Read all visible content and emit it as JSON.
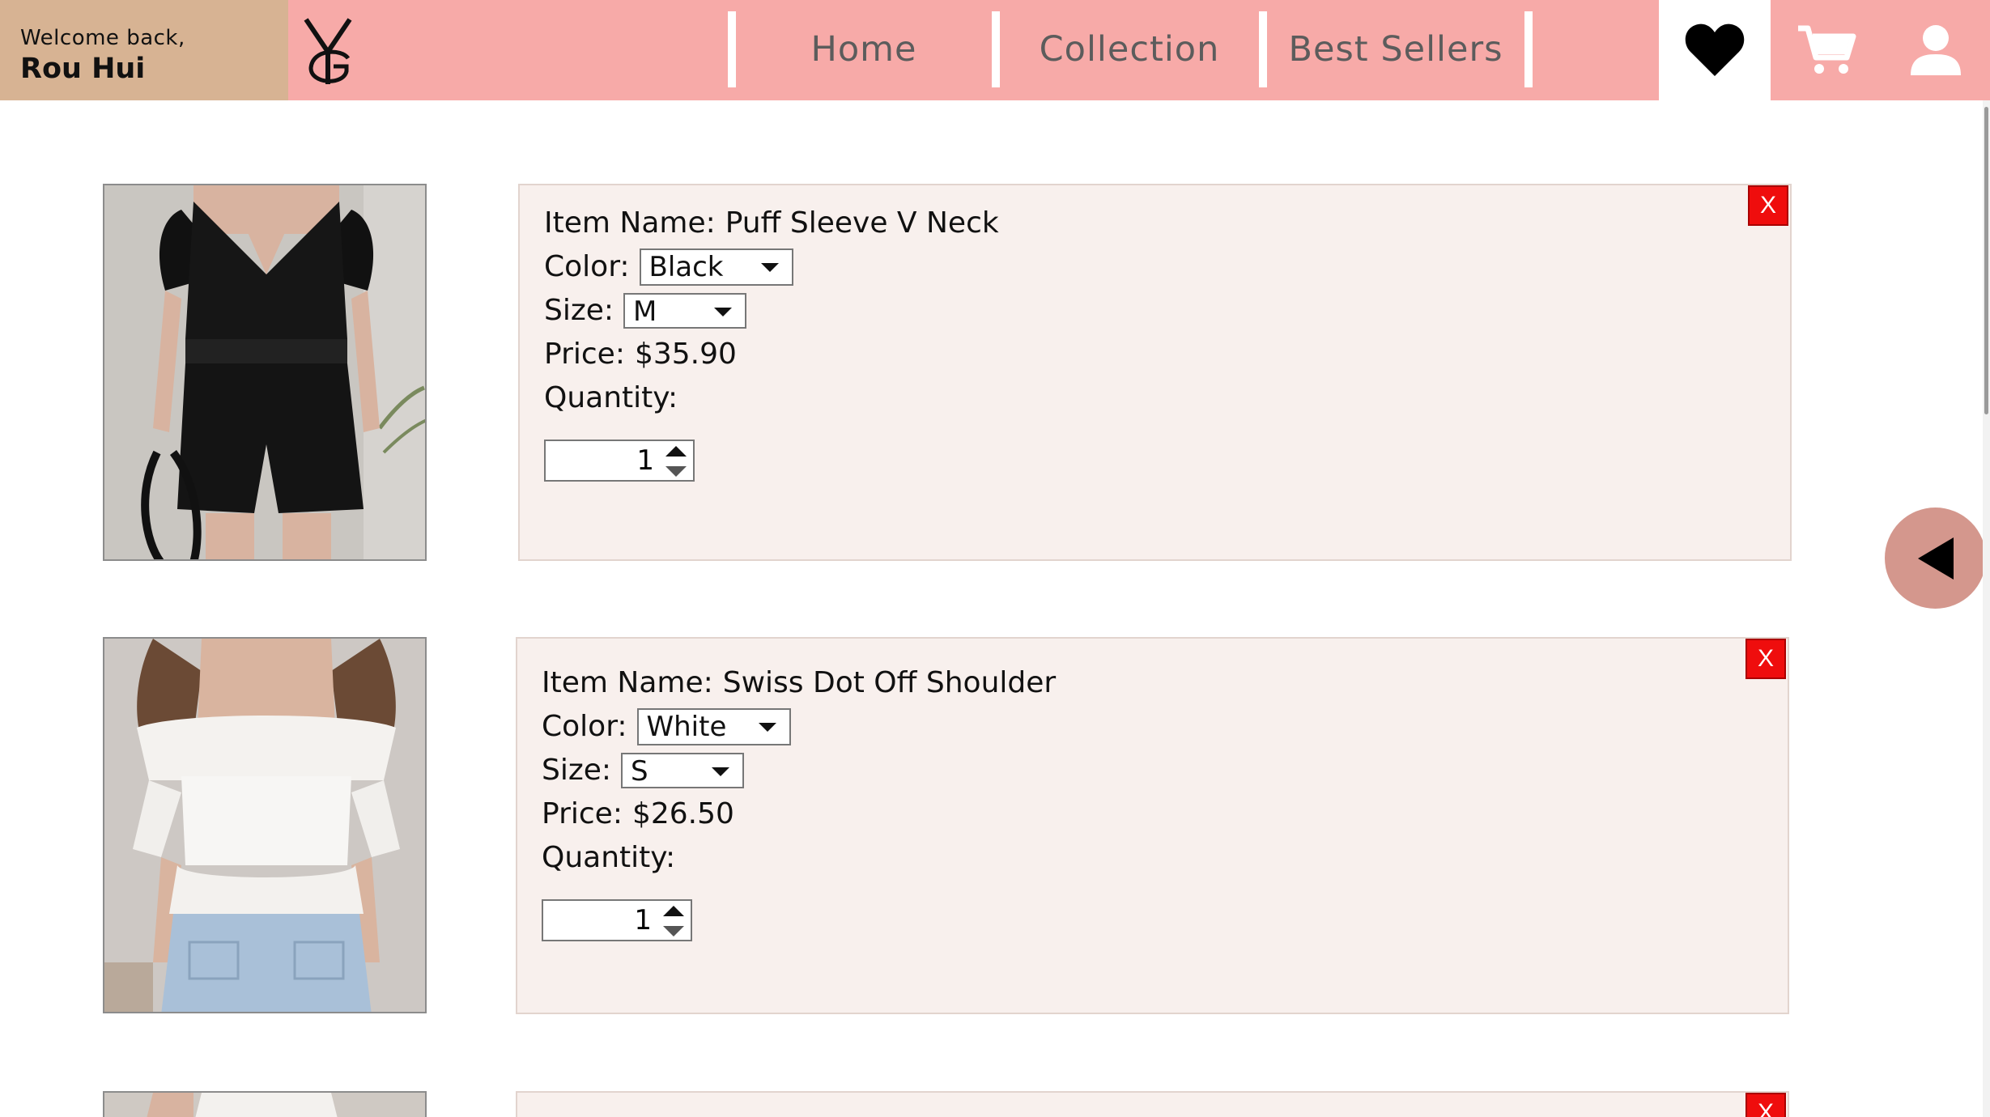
{
  "header": {
    "welcome_prefix": "Welcome back,",
    "user_name": "Rou Hui",
    "nav": [
      "Home",
      "Collection",
      "Best Sellers"
    ],
    "icons": [
      "heart-icon",
      "cart-icon",
      "user-icon"
    ]
  },
  "colors": {
    "header_bg": "#f7aaa8",
    "welcome_bg": "#d7b393",
    "card_bg": "#f8f0ed",
    "remove_btn": "#ef0d0d",
    "back_btn": "#d4978d"
  },
  "cart": {
    "labels": {
      "item_name": "Item Name:",
      "color": "Color:",
      "size": "Size:",
      "price": "Price:",
      "quantity": "Quantity:",
      "remove": "X"
    },
    "items": [
      {
        "name": "Puff Sleeve V Neck",
        "color": "Black",
        "size": "M",
        "price": "$35.90",
        "quantity": "1"
      },
      {
        "name": "Swiss Dot Off Shoulder",
        "color": "White",
        "size": "S",
        "price": "$26.50",
        "quantity": "1"
      }
    ]
  }
}
